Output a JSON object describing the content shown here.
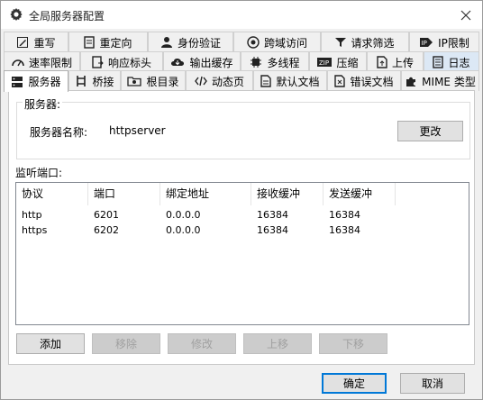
{
  "window": {
    "title": "全局服务器配置"
  },
  "tabs": {
    "row1": [
      {
        "label": "重写",
        "icon": "edit-icon"
      },
      {
        "label": "重定向",
        "icon": "document-icon"
      },
      {
        "label": "身份验证",
        "icon": "user-icon"
      },
      {
        "label": "跨域访问",
        "icon": "globe-icon"
      },
      {
        "label": "请求筛选",
        "icon": "filter-icon"
      },
      {
        "label": "IP限制",
        "icon": "ip-icon"
      }
    ],
    "row2": [
      {
        "label": "速率限制",
        "icon": "gauge-icon"
      },
      {
        "label": "响应标头",
        "icon": "response-icon"
      },
      {
        "label": "输出缓存",
        "icon": "cloud-download-icon"
      },
      {
        "label": "多线程",
        "icon": "cpu-icon"
      },
      {
        "label": "压缩",
        "icon": "zip-icon"
      },
      {
        "label": "上传",
        "icon": "upload-icon"
      },
      {
        "label": "日志",
        "icon": "log-icon"
      }
    ],
    "row3": [
      {
        "label": "服务器",
        "icon": "server-icon"
      },
      {
        "label": "桥接",
        "icon": "bridge-icon"
      },
      {
        "label": "根目录",
        "icon": "folder-icon"
      },
      {
        "label": "动态页",
        "icon": "code-icon"
      },
      {
        "label": "默认文档",
        "icon": "default-doc-icon"
      },
      {
        "label": "错误文档",
        "icon": "error-doc-icon"
      },
      {
        "label": "MIME 类型",
        "icon": "puzzle-icon"
      }
    ]
  },
  "server_group": {
    "label": "服务器:",
    "name_label": "服务器名称:",
    "name_value": "httpserver",
    "change_button": "更改"
  },
  "listen": {
    "label": "监听端口:",
    "columns": [
      "协议",
      "端口",
      "绑定地址",
      "接收缓冲",
      "发送缓冲"
    ],
    "rows": [
      [
        "http",
        "6201",
        "0.0.0.0",
        "16384",
        "16384"
      ],
      [
        "https",
        "6202",
        "0.0.0.0",
        "16384",
        "16384"
      ]
    ]
  },
  "actions": {
    "add": "添加",
    "remove": "移除",
    "modify": "修改",
    "move_up": "上移",
    "move_down": "下移"
  },
  "footer": {
    "ok": "确定",
    "cancel": "取消"
  }
}
